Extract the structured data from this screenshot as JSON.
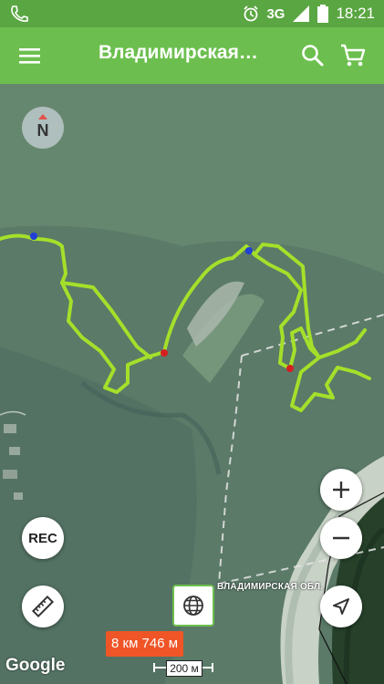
{
  "status_bar": {
    "network": "3G",
    "time": "18:21",
    "icons": [
      "phone-icon",
      "alarm-icon",
      "signal-icon",
      "battery-icon"
    ]
  },
  "app_bar": {
    "title": "Владимирская…",
    "icons": [
      "menu-icon",
      "search-icon",
      "cart-icon"
    ]
  },
  "map": {
    "compass_label": "N",
    "rec_label": "REC",
    "region_label": "ВЛАДИМИРСКАЯ ОБЛ.",
    "distance": "8 км 746 м",
    "scale_label": "200 м",
    "attribution": "Google",
    "track_color": "#a4e02a",
    "boundary_color": "#e6e6e6",
    "waypoint_colors": [
      "#1f3fd6",
      "#d42020"
    ]
  }
}
